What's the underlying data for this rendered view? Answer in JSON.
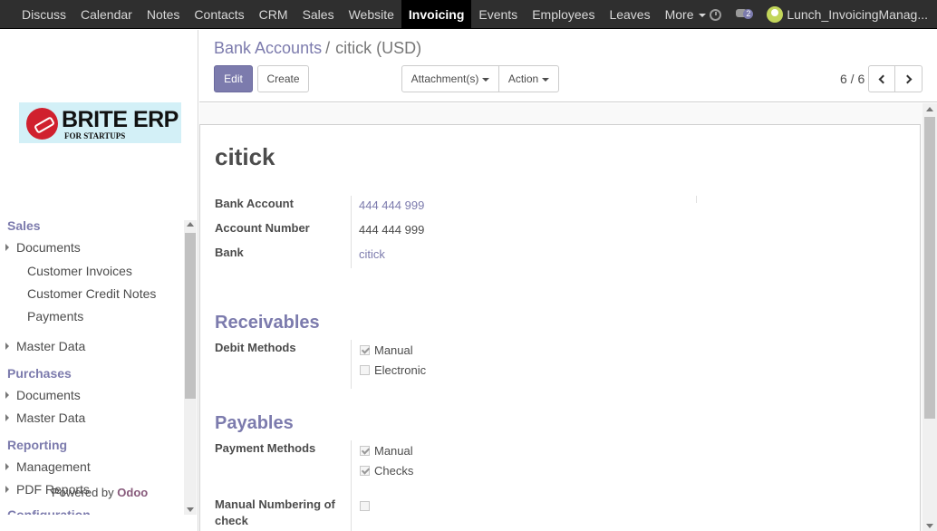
{
  "navbar": {
    "menus": [
      "Discuss",
      "Calendar",
      "Notes",
      "Contacts",
      "CRM",
      "Sales",
      "Website",
      "Invoicing",
      "Events",
      "Employees",
      "Leaves"
    ],
    "active_menu": "Invoicing",
    "more_label": "More",
    "chat_badge": "2",
    "username": "Lunch_InvoicingManag..."
  },
  "sidebar": {
    "logo": {
      "brand": "BRITE ERP",
      "tagline": "FOR STARTUPS"
    },
    "sections": {
      "sales": "Sales",
      "purchases": "Purchases",
      "reporting": "Reporting",
      "configuration": "Configuration"
    },
    "items": {
      "sales_documents": "Documents",
      "customer_invoices": "Customer Invoices",
      "customer_credit_notes": "Customer Credit Notes",
      "payments": "Payments",
      "sales_master_data": "Master Data",
      "purchases_documents": "Documents",
      "purchases_master_data": "Master Data",
      "management": "Management",
      "pdf_reports": "PDF Reports"
    },
    "powered_by": "Powered by",
    "powered_brand": "Odoo"
  },
  "control_panel": {
    "breadcrumb_parent": "Bank Accounts",
    "breadcrumb_separator": "/",
    "breadcrumb_current": "citick (USD)",
    "edit_label": "Edit",
    "create_label": "Create",
    "attachments_label": "Attachment(s)",
    "action_label": "Action",
    "pager": "6 / 6"
  },
  "record": {
    "title": "citick",
    "fields": {
      "bank_account_label": "Bank Account",
      "bank_account_value": "444 444 999",
      "account_number_label": "Account Number",
      "account_number_value": "444 444 999",
      "bank_label": "Bank",
      "bank_value": "citick"
    },
    "receivables": {
      "heading": "Receivables",
      "methods_label": "Debit Methods",
      "methods": [
        {
          "label": "Manual",
          "checked": true
        },
        {
          "label": "Electronic",
          "checked": false
        }
      ]
    },
    "payables": {
      "heading": "Payables",
      "methods_label": "Payment Methods",
      "methods": [
        {
          "label": "Manual",
          "checked": true
        },
        {
          "label": "Checks",
          "checked": true
        }
      ],
      "manual_numbering_label": "Manual Numbering of check",
      "manual_numbering_checked": false
    }
  },
  "colors": {
    "navbar_bg": "#2f2f2f",
    "accent": "#7c7bad",
    "odoo_brand": "#875a7b",
    "logo_red": "#d0202e"
  }
}
